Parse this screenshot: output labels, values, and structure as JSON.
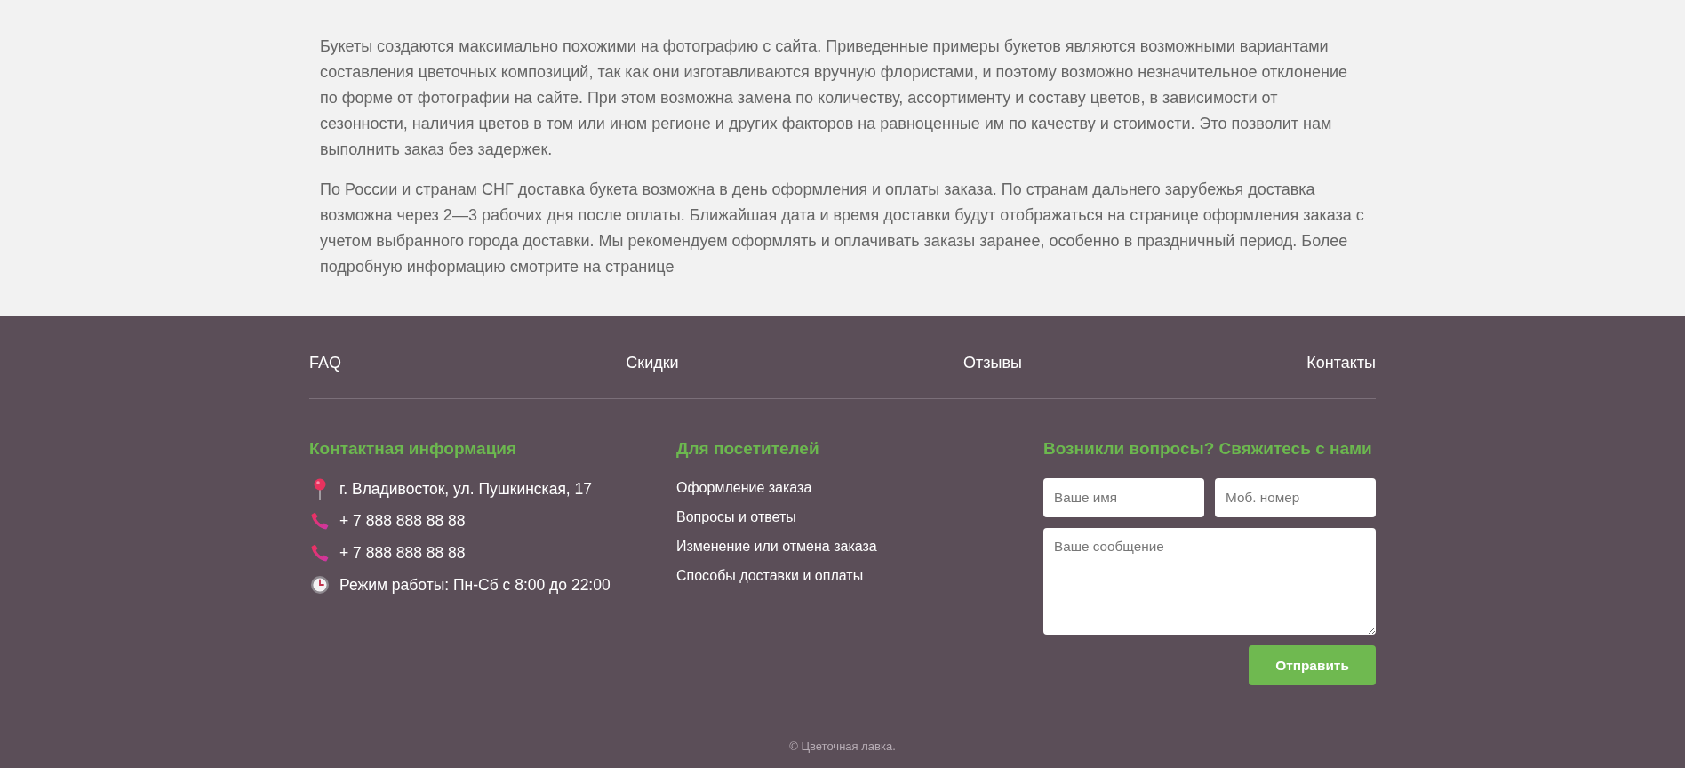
{
  "notice": {
    "paragraphs": [
      "Букеты создаются максимально похожими на фотографию с сайта. Приведенные примеры букетов являются возможными вариантами составления цветочных композиций, так как они изготавливаются вручную флористами, и поэтому возможно незначительное отклонение по форме от фотографии на сайте. При этом возможна замена по количеству, ассортименту и составу цветов, в зависимости от сезонности, наличия цветов в том или ином регионе и других факторов на равноценные им по качеству и стоимости. Это позволит нам выполнить заказ без задержек.",
      "По России и странам СНГ доставка букета возможна в день оформления и оплаты заказа. По странам дальнего зарубежья доставка возможна через 2—3 рабочих дня после оплаты. Ближайшая дата и время доставки будут отображаться на странице оформления заказа с учетом выбранного города доставки. Мы рекомендуем оформлять и оплачивать заказы заранее, особенно в праздничный период. Более подробную информацию смотрите на странице"
    ]
  },
  "footer": {
    "nav": [
      {
        "label": "FAQ"
      },
      {
        "label": "Скидки"
      },
      {
        "label": "Отзывы"
      },
      {
        "label": "Контакты"
      }
    ],
    "contacts": {
      "title": "Контактная информация",
      "items": [
        {
          "kind": "address",
          "text": "г. Владивосток, ул. Пушкинская, 17"
        },
        {
          "kind": "phone",
          "text": "+ 7 888 888 88 88"
        },
        {
          "kind": "phone",
          "text": "+ 7 888 888 88 88"
        },
        {
          "kind": "hours",
          "text": "Режим работы: Пн-Сб с 8:00 до 22:00"
        }
      ]
    },
    "visitors": {
      "title": "Для посетителей",
      "links": [
        {
          "label": "Оформление заказа"
        },
        {
          "label": "Вопросы и ответы"
        },
        {
          "label": "Изменение или отмена заказа"
        },
        {
          "label": "Способы доставки и оплаты"
        }
      ]
    },
    "feedback": {
      "title": "Возникли вопросы? Свяжитесь с нами",
      "fields": [
        {
          "placeholder": "Ваше имя"
        },
        {
          "placeholder": "Моб. номер"
        }
      ],
      "message": {
        "placeholder": "Ваше сообщение"
      },
      "submit": "Отправить"
    },
    "copyright": "© Цветочная лавка."
  }
}
